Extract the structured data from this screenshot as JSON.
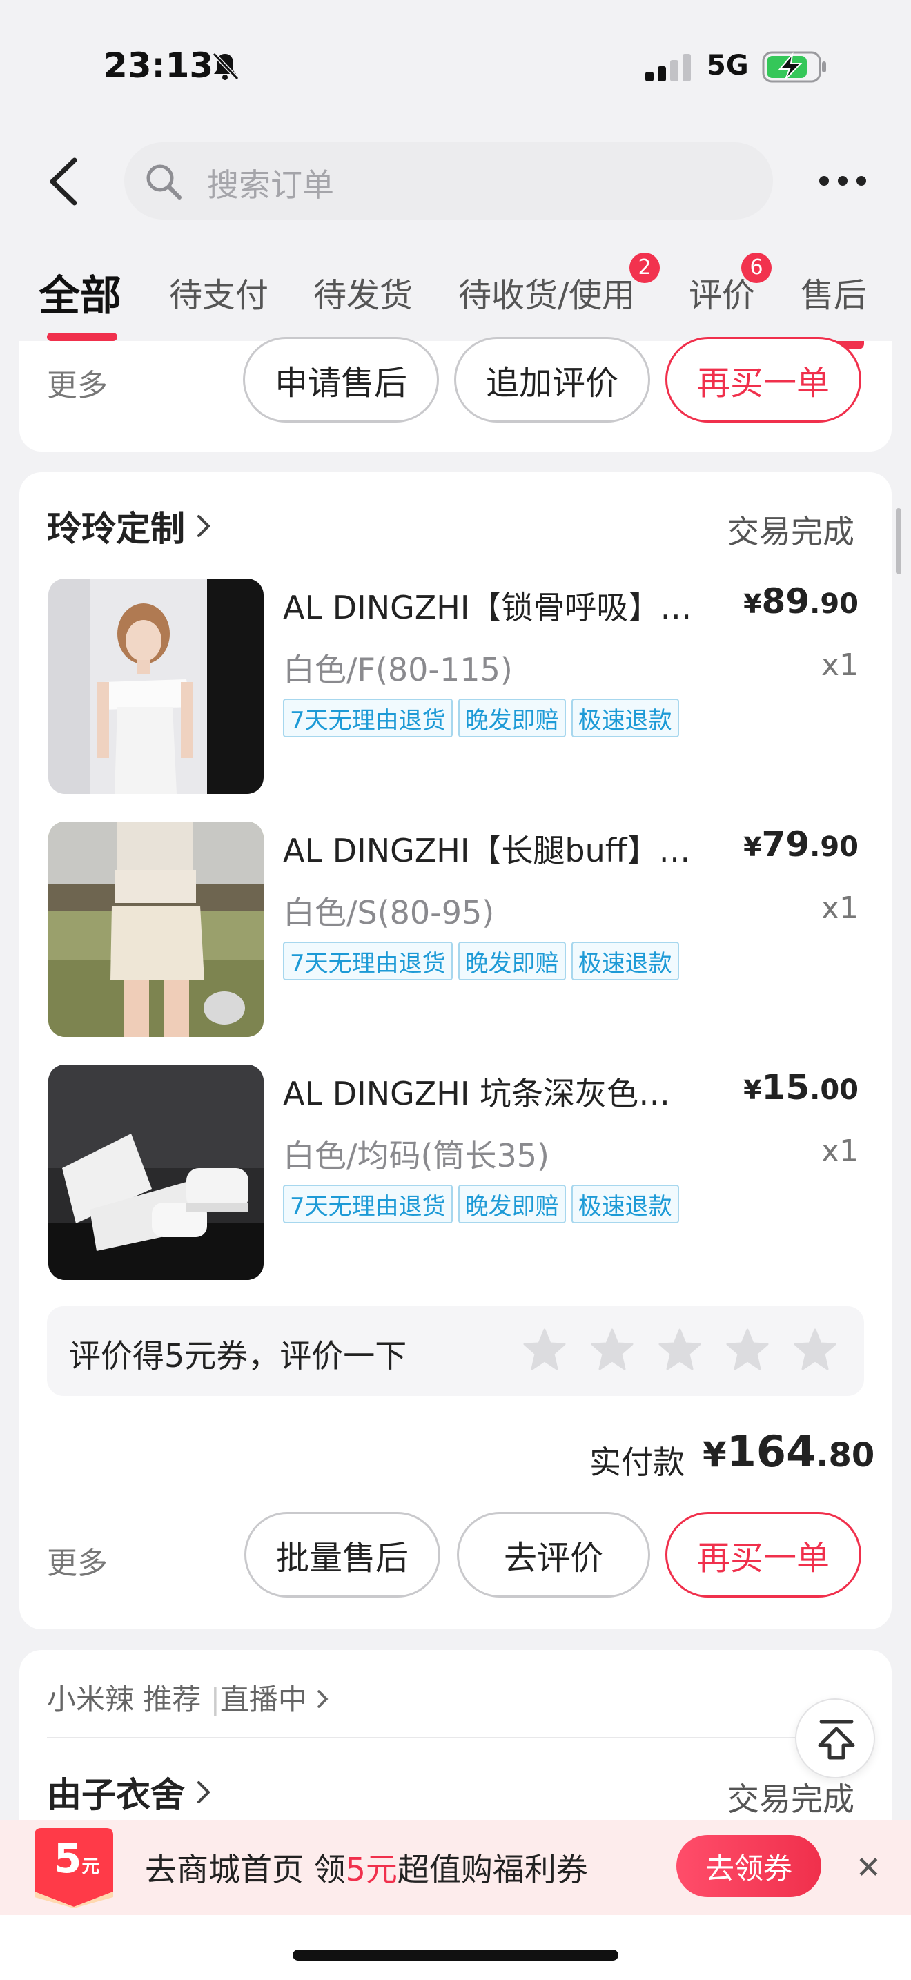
{
  "status_bar": {
    "time": "23:13",
    "network": "5G",
    "bell_icon": "bell-slash-icon",
    "battery_icon": "battery-charging-icon"
  },
  "nav": {
    "search_placeholder": "搜索订单",
    "back_icon": "back-arrow-icon",
    "more_icon": "more-dots-icon"
  },
  "tabs": [
    {
      "label": "全部",
      "active": true
    },
    {
      "label": "待支付"
    },
    {
      "label": "待发货"
    },
    {
      "label": "待收货/使用",
      "badge": "2"
    },
    {
      "label": "评价",
      "badge": "6"
    },
    {
      "label": "售后"
    }
  ],
  "order_prev": {
    "more": "更多",
    "buttons": [
      "申请售后",
      "追加评价",
      "再买一单"
    ]
  },
  "order_main": {
    "store": "玲玲定制",
    "status": "交易完成",
    "items": [
      {
        "title": "AL DINGZHI【锁骨呼吸】…",
        "spec": "白色/F(80-115)",
        "price_symbol": "¥",
        "price_int": "89",
        "price_dec": ".90",
        "qty": "x1",
        "tags": [
          "7天无理由退货",
          "晚发即赔",
          "极速退款"
        ]
      },
      {
        "title": "AL DINGZHI【长腿buff】…",
        "spec": "白色/S(80-95)",
        "price_symbol": "¥",
        "price_int": "79",
        "price_dec": ".90",
        "qty": "x1",
        "tags": [
          "7天无理由退货",
          "晚发即赔",
          "极速退款"
        ]
      },
      {
        "title": "AL DINGZHI 坑条深灰色小…",
        "spec": "白色/均码(筒长35)",
        "price_symbol": "¥",
        "price_int": "15",
        "price_dec": ".00",
        "qty": "x1",
        "tags": [
          "7天无理由退货",
          "晚发即赔",
          "极速退款"
        ]
      }
    ],
    "review_prompt": "评价得5元券，评价一下",
    "stars": 5,
    "paid_label": "实付款",
    "paid_symbol": "¥",
    "paid_int": "164",
    "paid_dec": ".80",
    "more": "更多",
    "buttons": [
      "批量售后",
      "去评价",
      "再买一单"
    ]
  },
  "order_next": {
    "rec_source": "小米辣",
    "rec_label": "推荐",
    "rec_live": "直播中",
    "store": "由子衣舍",
    "status": "交易完成"
  },
  "coupon_bar": {
    "badge_amount": "5",
    "badge_unit": "元",
    "text_prefix": "去商城首页 领",
    "text_amount": "5元",
    "text_suffix": "超值购福利券",
    "button": "去领券",
    "close": "✕"
  },
  "colors": {
    "accent": "#f0304c",
    "tag_blue": "#1d9ad6"
  }
}
